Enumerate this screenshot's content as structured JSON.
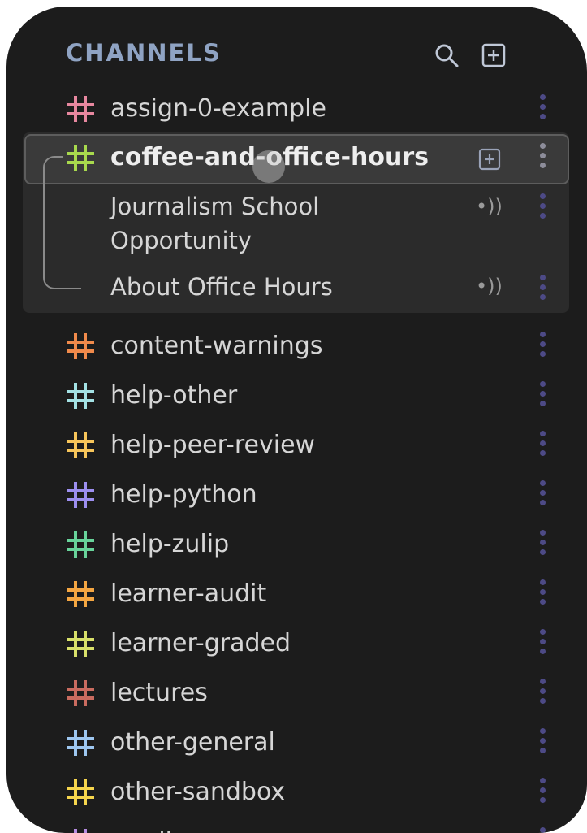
{
  "header": {
    "title": "CHANNELS",
    "search_icon": "search-icon",
    "add_icon": "add-channel-icon"
  },
  "selected_channel": {
    "name": "coffee-and-office-hours",
    "color": "#a8d94d",
    "topics": [
      {
        "name": "Journalism School Opportunity",
        "status": "•))"
      },
      {
        "name": "About Office Hours",
        "status": "•))"
      }
    ]
  },
  "channels_before": [
    {
      "name": "assign-0-example",
      "color": "#e7879f"
    }
  ],
  "channels_after": [
    {
      "name": "content-warnings",
      "color": "#f08a4b"
    },
    {
      "name": "help-other",
      "color": "#a3e1e4"
    },
    {
      "name": "help-peer-review",
      "color": "#f7c55a"
    },
    {
      "name": "help-python",
      "color": "#9d8ff0"
    },
    {
      "name": "help-zulip",
      "color": "#68d39a"
    },
    {
      "name": "learner-audit",
      "color": "#f4a642"
    },
    {
      "name": "learner-graded",
      "color": "#d8e06a"
    },
    {
      "name": "lectures",
      "color": "#c96b5f"
    },
    {
      "name": "other-general",
      "color": "#9ec7f0"
    },
    {
      "name": "other-sandbox",
      "color": "#f6d54d"
    },
    {
      "name": "reading",
      "color": "#b58ce0"
    }
  ],
  "colors": {
    "panel": "#1c1c1c",
    "kebab": "#4d4a86",
    "header_text": "#8fa3c3"
  }
}
